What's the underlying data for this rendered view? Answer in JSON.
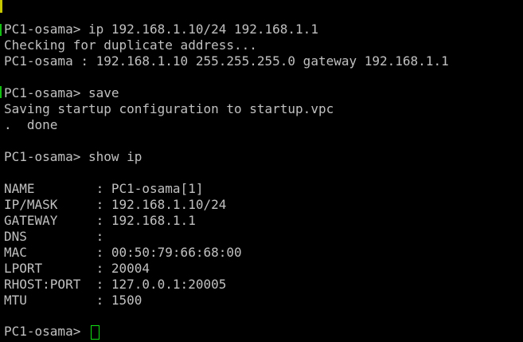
{
  "terminal": {
    "lines": [
      "PC1-osama> ip 192.168.1.10/24 192.168.1.1",
      "Checking for duplicate address...",
      "PC1-osama : 192.168.1.10 255.255.255.0 gateway 192.168.1.1",
      "",
      "PC1-osama> save",
      "Saving startup configuration to startup.vpc",
      ".  done",
      "",
      "PC1-osama> show ip",
      "",
      "NAME        : PC1-osama[1]",
      "IP/MASK     : 192.168.1.10/24",
      "GATEWAY     : 192.168.1.1",
      "DNS         :",
      "MAC         : 00:50:79:66:68:00",
      "LPORT       : 20004",
      "RHOST:PORT  : 127.0.0.1:20005",
      "MTU         : 1500",
      "",
      "PC1-osama> "
    ]
  },
  "colors": {
    "background": "#000000",
    "text": "#c0c0c0",
    "cursor": "#12e012"
  }
}
